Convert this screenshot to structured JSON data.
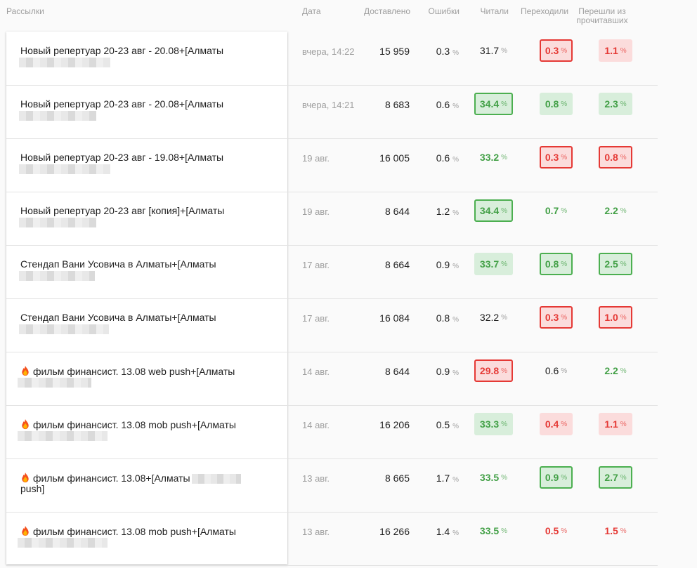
{
  "headers": {
    "name": "Рассылки",
    "date": "Дата",
    "delivered": "Доставлено",
    "errors": "Ошибки",
    "read": "Читали",
    "clicked": "Переходили",
    "ctr_line1": "Перешли из",
    "ctr_line2": "прочитавших"
  },
  "pct_sign": "%",
  "colors": {
    "green": "#43a047",
    "red": "#e53935"
  },
  "rows": [
    {
      "name": "Новый репертуар 20-23 авг - 20.08+[Алматы",
      "fire": false,
      "date": "вчера, 14:22",
      "delivered": "15 959",
      "errors": "0.3",
      "read": "31.7",
      "read_style": "plain",
      "click": "0.3",
      "click_style": "red-border",
      "ctr": "1.1",
      "ctr_style": "red-bg"
    },
    {
      "name": "Новый репертуар 20-23 авг - 20.08+[Алматы",
      "fire": false,
      "date": "вчера, 14:21",
      "delivered": "8 683",
      "errors": "0.6",
      "read": "34.4",
      "read_style": "green-border",
      "click": "0.8",
      "click_style": "green-bg",
      "ctr": "2.3",
      "ctr_style": "green-bg"
    },
    {
      "name": "Новый репертуар 20-23 авг - 19.08+[Алматы",
      "fire": false,
      "date": "19 авг.",
      "delivered": "16 005",
      "errors": "0.6",
      "read": "33.2",
      "read_style": "green-text",
      "click": "0.3",
      "click_style": "red-border",
      "ctr": "0.8",
      "ctr_style": "red-border"
    },
    {
      "name": "Новый репертуар 20-23 авг [копия]+[Алматы",
      "fire": false,
      "date": "19 авг.",
      "delivered": "8 644",
      "errors": "1.2",
      "read": "34.4",
      "read_style": "green-border",
      "click": "0.7",
      "click_style": "green-text",
      "ctr": "2.2",
      "ctr_style": "green-text"
    },
    {
      "name": "Стендап Вани Усовича в Алматы+[Алматы",
      "fire": false,
      "date": "17 авг.",
      "delivered": "8 664",
      "errors": "0.9",
      "read": "33.7",
      "read_style": "green-bg",
      "click": "0.8",
      "click_style": "green-border",
      "ctr": "2.5",
      "ctr_style": "green-border"
    },
    {
      "name": "Стендап Вани Усовича в Алматы+[Алматы",
      "fire": false,
      "date": "17 авг.",
      "delivered": "16 084",
      "errors": "0.8",
      "read": "32.2",
      "read_style": "plain",
      "click": "0.3",
      "click_style": "red-border",
      "ctr": "1.0",
      "ctr_style": "red-border"
    },
    {
      "name": "фильм финансист. 13.08 web push+[Алматы",
      "fire": true,
      "date": "14 авг.",
      "delivered": "8 644",
      "errors": "0.9",
      "read": "29.8",
      "read_style": "red-border",
      "click": "0.6",
      "click_style": "plain",
      "ctr": "2.2",
      "ctr_style": "green-text"
    },
    {
      "name": "фильм финансист. 13.08 mob push+[Алматы",
      "fire": true,
      "date": "14 авг.",
      "delivered": "16 206",
      "errors": "0.5",
      "read": "33.3",
      "read_style": "green-bg",
      "click": "0.4",
      "click_style": "red-bg",
      "ctr": "1.1",
      "ctr_style": "red-bg"
    },
    {
      "name": "фильм финансист. 13.08+[Алматы",
      "name_tail": "push]",
      "fire": true,
      "date": "13 авг.",
      "delivered": "8 665",
      "errors": "1.7",
      "read": "33.5",
      "read_style": "green-text",
      "click": "0.9",
      "click_style": "green-border",
      "ctr": "2.7",
      "ctr_style": "green-border"
    },
    {
      "name": "фильм финансист. 13.08 mob push+[Алматы",
      "fire": true,
      "date": "13 авг.",
      "delivered": "16 266",
      "errors": "1.4",
      "read": "33.5",
      "read_style": "green-text",
      "click": "0.5",
      "click_style": "red-text",
      "ctr": "1.5",
      "ctr_style": "red-text"
    }
  ]
}
